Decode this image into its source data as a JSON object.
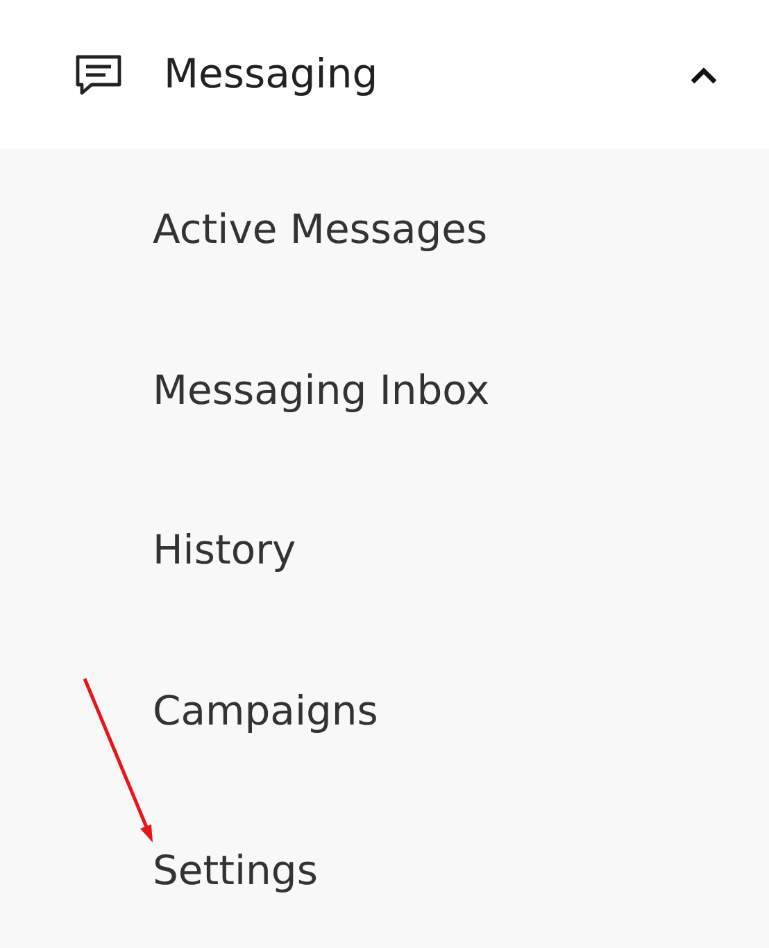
{
  "menu": {
    "label": "Messaging",
    "expanded": true,
    "items": [
      {
        "label": "Active Messages"
      },
      {
        "label": "Messaging Inbox"
      },
      {
        "label": "History"
      },
      {
        "label": "Campaigns"
      },
      {
        "label": "Settings"
      }
    ]
  }
}
